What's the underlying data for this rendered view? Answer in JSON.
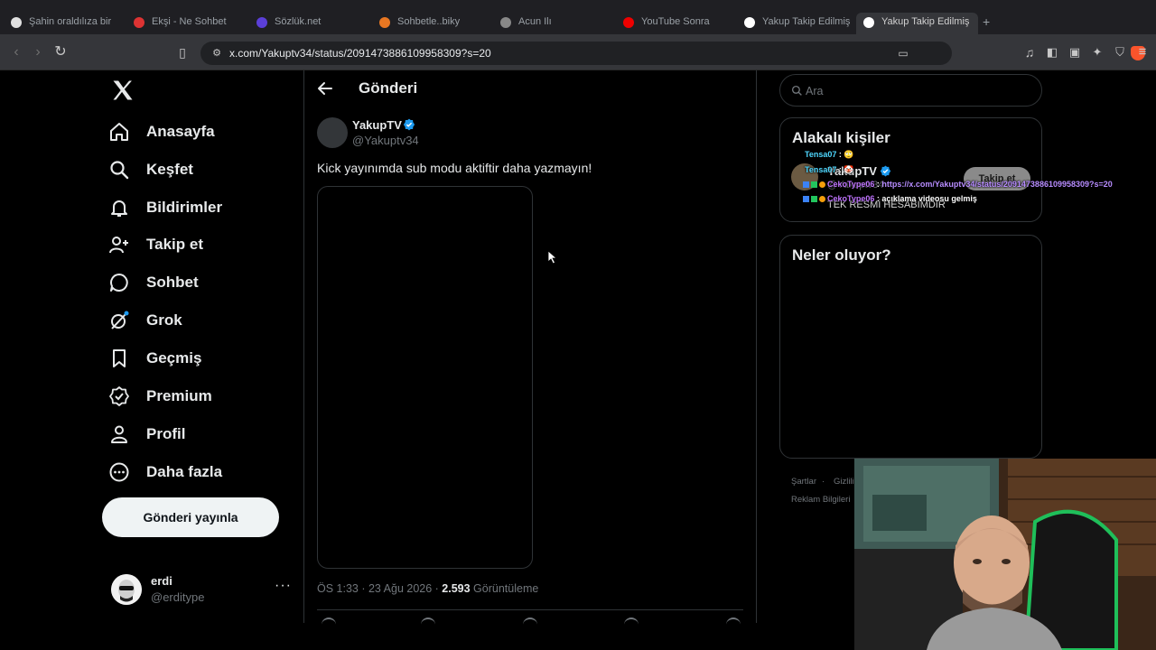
{
  "browser": {
    "tabs": [
      {
        "label": "Şahin oraldılıza bir",
        "color": "#e0e0e0"
      },
      {
        "label": "Ekşi - Ne Sohbet",
        "color": "#d33"
      },
      {
        "label": "Sözlük.net",
        "color": "#5b3fd8"
      },
      {
        "label": "Sohbetle..biky",
        "color": "#e87722"
      },
      {
        "label": "Acun Ilı",
        "color": "#888"
      },
      {
        "label": "YouTube Sonra",
        "color": "#e00"
      },
      {
        "label": "Yakup Takip Edilmiş",
        "color": "#fff"
      },
      {
        "label": "Yakup Takip Edilmiş",
        "color": "#fff"
      }
    ],
    "url": "x.com/Yakuptv34/status/2091473886109958309?s=20"
  },
  "nav": {
    "items": [
      {
        "label": "Anasayfa"
      },
      {
        "label": "Keşfet"
      },
      {
        "label": "Bildirimler"
      },
      {
        "label": "Takip et"
      },
      {
        "label": "Sohbet"
      },
      {
        "label": "Grok"
      },
      {
        "label": "Geçmiş"
      },
      {
        "label": "Premium"
      },
      {
        "label": "Profil"
      },
      {
        "label": "Daha fazla"
      }
    ],
    "post_button": "Gönderi yayınla",
    "account": {
      "name": "erdi",
      "handle": "@erditype"
    }
  },
  "post": {
    "header": "Gönderi",
    "author_name": "YakupTV",
    "author_handle": "@Yakuptv34",
    "text": "Kick yayınımda sub modu aktiftir daha yazmayın!",
    "time": "ÖS 1:33 · 23 Ağu 2026 · ",
    "views": "2.593",
    "views_label": " Görüntüleme"
  },
  "sidebar": {
    "search_placeholder": "Ara",
    "related_title": "Alakalı kişiler",
    "related": {
      "name": "YakupTV",
      "handle": "@Yakuptv34",
      "bio": "TEK RESMİ HESABIMDIR",
      "follow_label": "Takip et"
    },
    "trends_title": "Neler oluyor?",
    "footer": [
      "Şartlar",
      "Gizlilik",
      "Reklam Bilgileri"
    ]
  },
  "chat": [
    {
      "user": "Tensa07",
      "msg": "🙄"
    },
    {
      "user": "Tensa07",
      "msg": "🤡"
    },
    {
      "user": "CekoType06",
      "msg": "https://x.com/Yakuptv34/status/2091473886109958309?s=20"
    },
    {
      "user": "CekoType06",
      "msg": "açıklama videosu gelmiş"
    }
  ],
  "colors": {
    "verified": "#1d9bf0",
    "chat_user_a": "#4fd8ff",
    "chat_user_b": "#c074ff"
  }
}
